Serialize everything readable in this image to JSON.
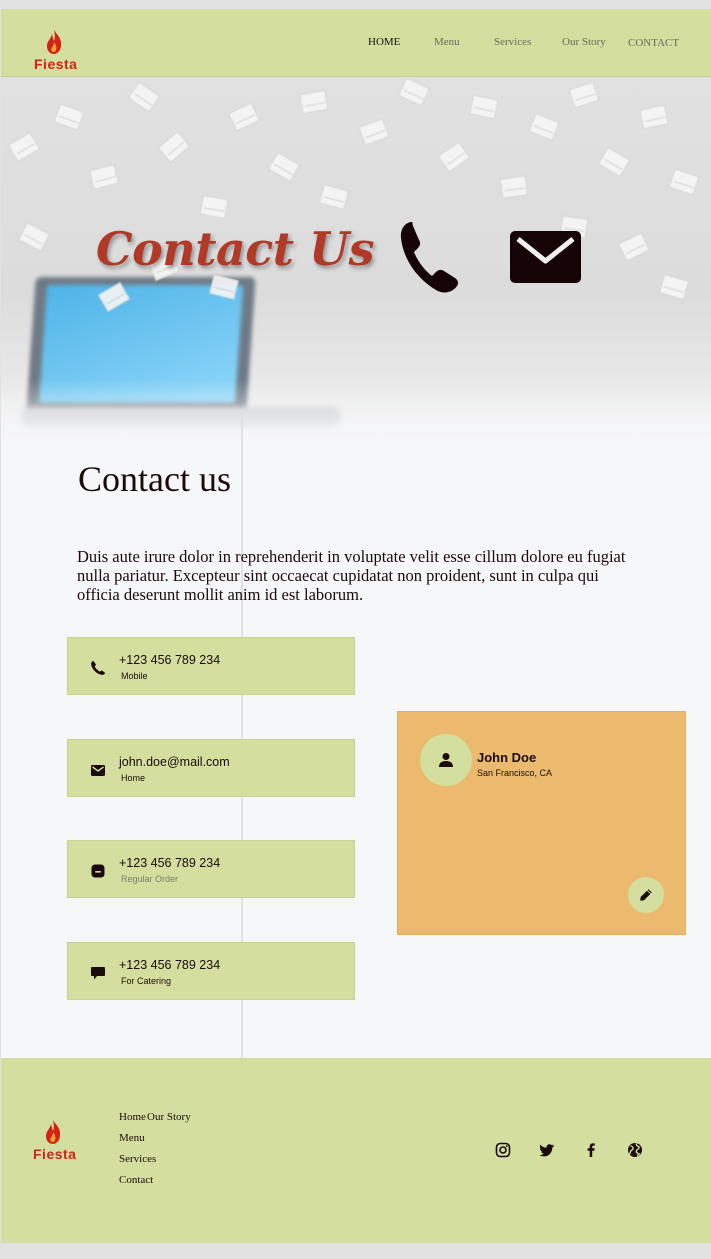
{
  "brand": {
    "name": "Fiesta",
    "color": "#d2231b"
  },
  "nav": {
    "items": [
      {
        "label": "HOME",
        "active": true
      },
      {
        "label": "Menu",
        "active": false
      },
      {
        "label": "Services",
        "active": false
      },
      {
        "label": "Our Story",
        "active": false
      },
      {
        "label": "CONTACT",
        "active": false
      }
    ]
  },
  "hero": {
    "title": "Contact Us",
    "icons": [
      "phone-icon",
      "envelope-icon"
    ]
  },
  "contact": {
    "title": "Contact us",
    "text": "Duis aute irure dolor in reprehenderit in voluptate velit esse cillum dolore eu fugiat nulla pariatur. Excepteur sint occaecat cupidatat non proident, sunt in culpa qui officia deserunt mollit anim id est laborum.",
    "cards": [
      {
        "icon": "phone-icon",
        "main": "+123 456 789 234",
        "sub": "Mobile"
      },
      {
        "icon": "envelope-icon",
        "main": "john.doe@mail.com",
        "sub": "Home"
      },
      {
        "icon": "phone-square-icon",
        "main": "+123 456 789 234",
        "sub": "Regular Order"
      },
      {
        "icon": "chat-icon",
        "main": "+123 456 789 234",
        "sub": "For Catering"
      }
    ]
  },
  "profile": {
    "name": "John Doe",
    "location": "San Francisco, CA",
    "avatar_icon": "person-icon",
    "edit_icon": "pencil-icon"
  },
  "footer": {
    "links": [
      "Home",
      "Our Story",
      "Menu",
      "Services",
      "Contact"
    ],
    "social": [
      "instagram-icon",
      "twitter-icon",
      "facebook-icon",
      "globe-icon"
    ]
  },
  "colors": {
    "header_bg": "#d4df9f",
    "profile_bg": "#ebba6e",
    "hero_title": "#b03a27",
    "page_bg": "#f6f7f9"
  }
}
